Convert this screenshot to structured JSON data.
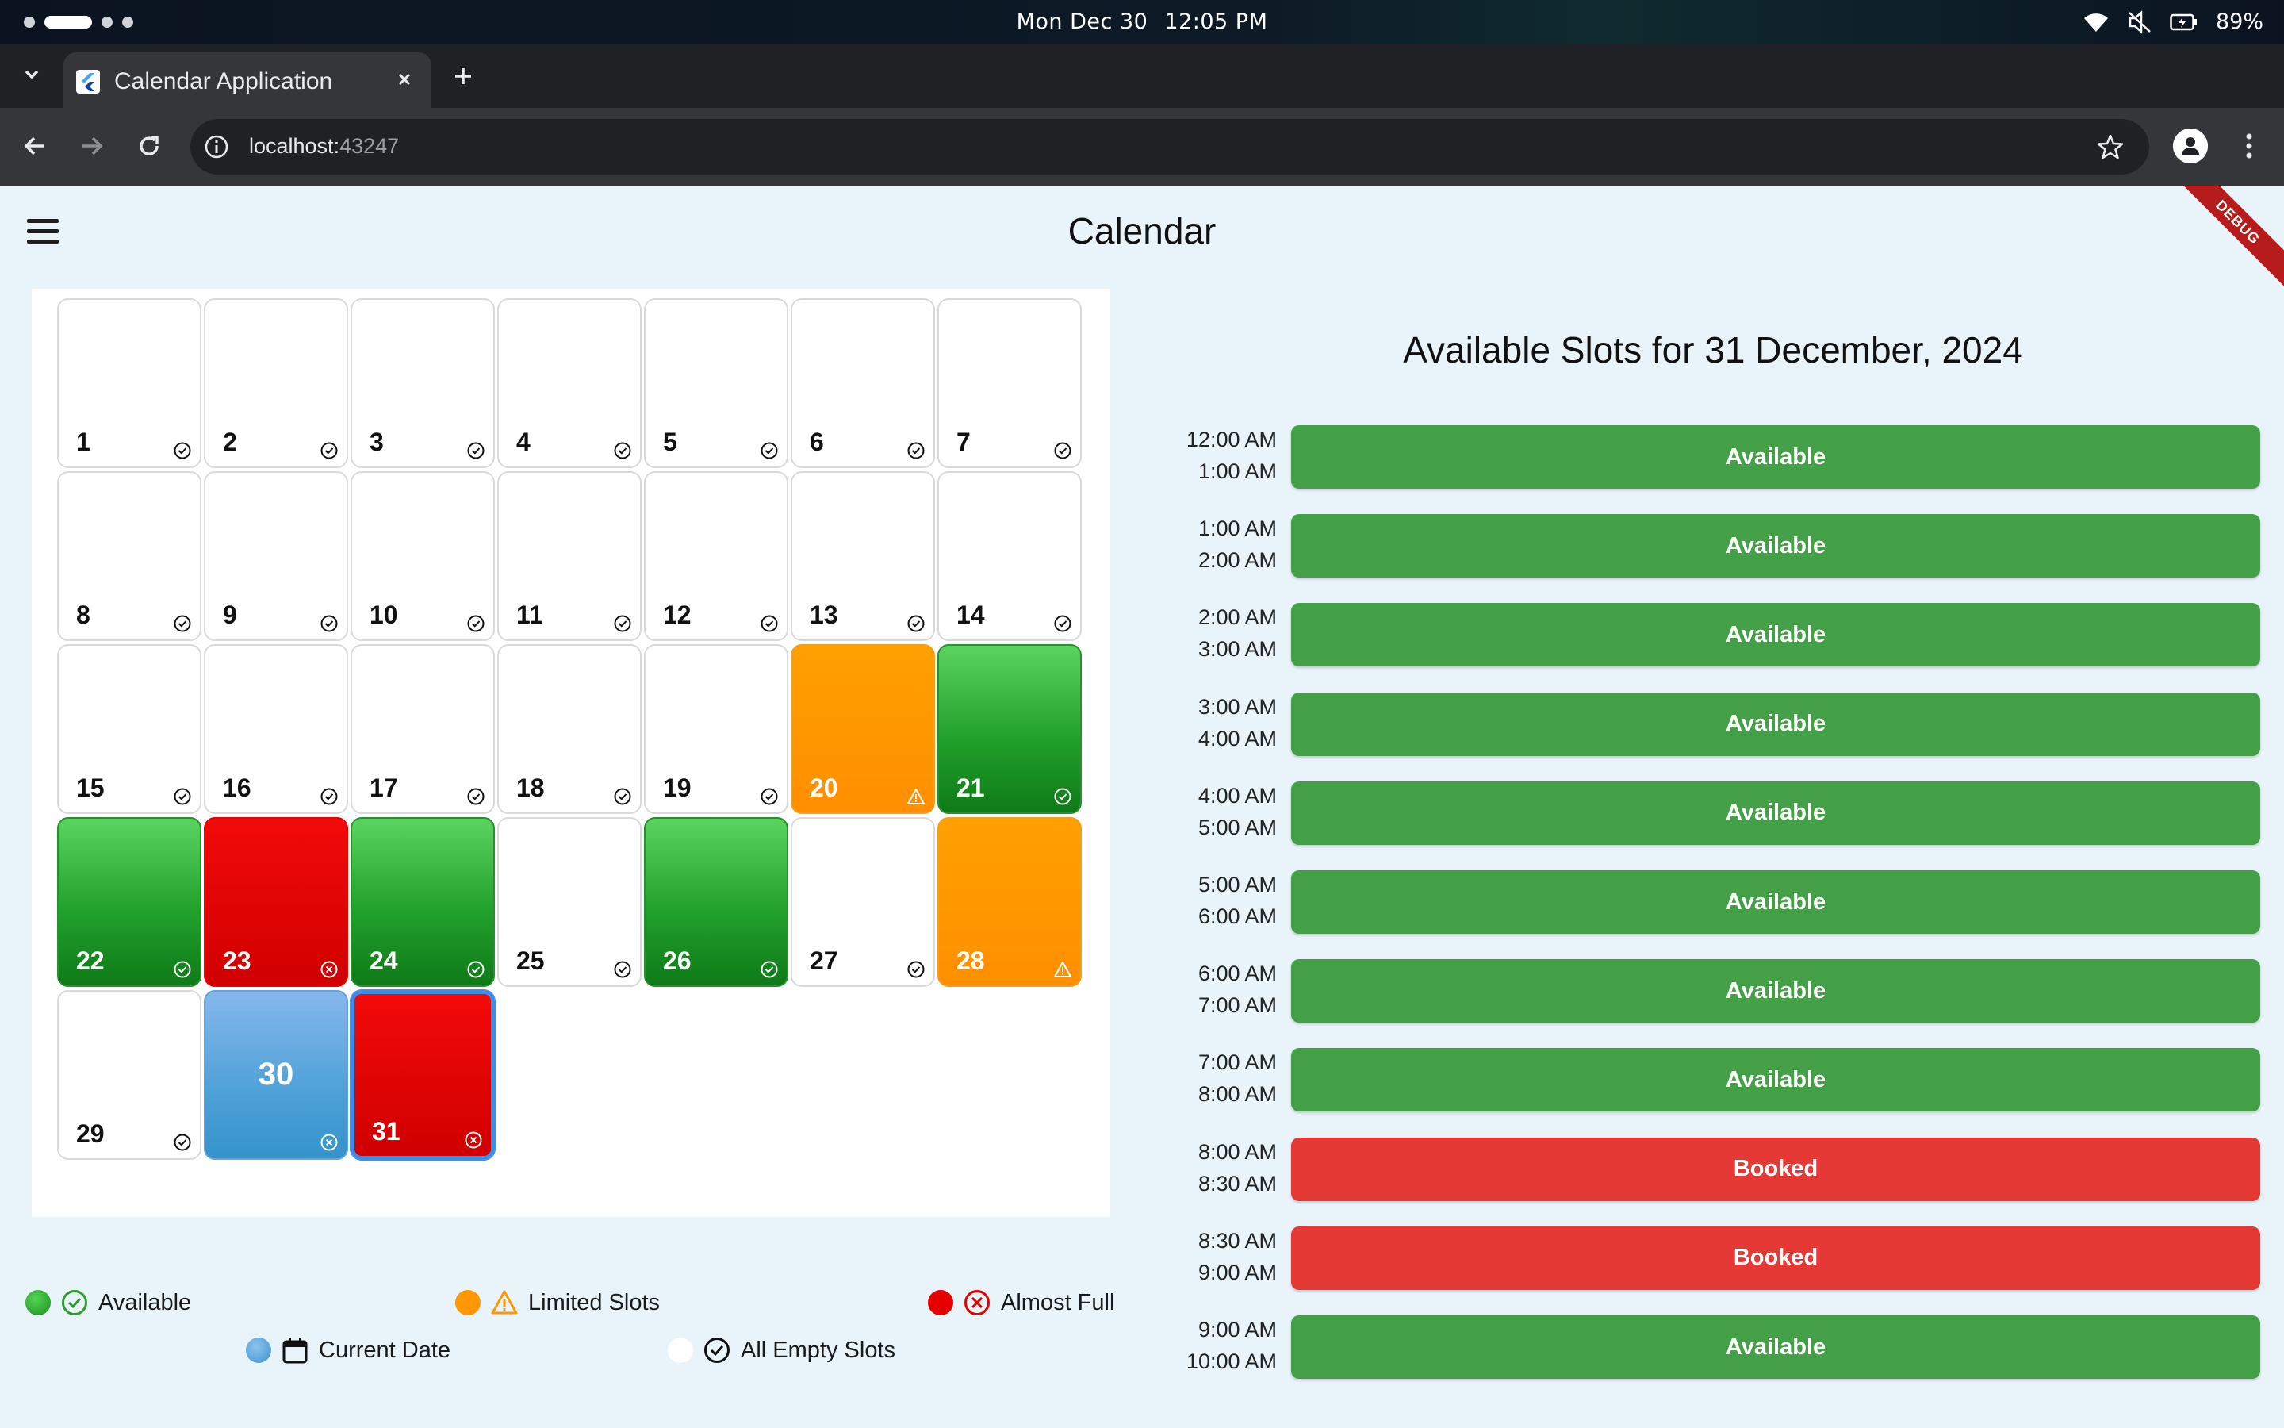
{
  "os": {
    "clock_day": "Mon Dec 30",
    "clock_time": "12:05 PM",
    "battery": "89%"
  },
  "browser": {
    "tab_title": "Calendar Application",
    "url_host": "localhost:",
    "url_port": "43247"
  },
  "app": {
    "title": "Calendar",
    "debug_banner": "DEBUG"
  },
  "calendar": {
    "days": [
      {
        "n": "1",
        "s": "empty",
        "icon": "check"
      },
      {
        "n": "2",
        "s": "empty",
        "icon": "check"
      },
      {
        "n": "3",
        "s": "empty",
        "icon": "check"
      },
      {
        "n": "4",
        "s": "empty",
        "icon": "check"
      },
      {
        "n": "5",
        "s": "empty",
        "icon": "check"
      },
      {
        "n": "6",
        "s": "empty",
        "icon": "check"
      },
      {
        "n": "7",
        "s": "empty",
        "icon": "check"
      },
      {
        "n": "8",
        "s": "empty",
        "icon": "check"
      },
      {
        "n": "9",
        "s": "empty",
        "icon": "check"
      },
      {
        "n": "10",
        "s": "empty",
        "icon": "check"
      },
      {
        "n": "11",
        "s": "empty",
        "icon": "check"
      },
      {
        "n": "12",
        "s": "empty",
        "icon": "check"
      },
      {
        "n": "13",
        "s": "empty",
        "icon": "check"
      },
      {
        "n": "14",
        "s": "empty",
        "icon": "check"
      },
      {
        "n": "15",
        "s": "empty",
        "icon": "check"
      },
      {
        "n": "16",
        "s": "empty",
        "icon": "check"
      },
      {
        "n": "17",
        "s": "empty",
        "icon": "check"
      },
      {
        "n": "18",
        "s": "empty",
        "icon": "check"
      },
      {
        "n": "19",
        "s": "empty",
        "icon": "check"
      },
      {
        "n": "20",
        "s": "orange",
        "icon": "warning"
      },
      {
        "n": "21",
        "s": "green",
        "icon": "check"
      },
      {
        "n": "22",
        "s": "green",
        "icon": "check"
      },
      {
        "n": "23",
        "s": "red",
        "icon": "cross"
      },
      {
        "n": "24",
        "s": "green",
        "icon": "check"
      },
      {
        "n": "25",
        "s": "empty",
        "icon": "check"
      },
      {
        "n": "26",
        "s": "green",
        "icon": "check"
      },
      {
        "n": "27",
        "s": "empty",
        "icon": "check"
      },
      {
        "n": "28",
        "s": "orange",
        "icon": "warning"
      },
      {
        "n": "29",
        "s": "empty",
        "icon": "check"
      },
      {
        "n": "30",
        "s": "current",
        "icon": "cross"
      },
      {
        "n": "31",
        "s": "red selected",
        "icon": "cross"
      }
    ]
  },
  "legend": {
    "available": "Available",
    "limited": "Limited Slots",
    "almost_full": "Almost Full",
    "current": "Current Date",
    "empty": "All Empty Slots"
  },
  "slots": {
    "title": "Available Slots for 31 December, 2024",
    "items": [
      {
        "start": "12:00 AM",
        "end": "1:00 AM",
        "label": "Available",
        "status": "available"
      },
      {
        "start": "1:00 AM",
        "end": "2:00 AM",
        "label": "Available",
        "status": "available"
      },
      {
        "start": "2:00 AM",
        "end": "3:00 AM",
        "label": "Available",
        "status": "available"
      },
      {
        "start": "3:00 AM",
        "end": "4:00 AM",
        "label": "Available",
        "status": "available"
      },
      {
        "start": "4:00 AM",
        "end": "5:00 AM",
        "label": "Available",
        "status": "available"
      },
      {
        "start": "5:00 AM",
        "end": "6:00 AM",
        "label": "Available",
        "status": "available"
      },
      {
        "start": "6:00 AM",
        "end": "7:00 AM",
        "label": "Available",
        "status": "available"
      },
      {
        "start": "7:00 AM",
        "end": "8:00 AM",
        "label": "Available",
        "status": "available"
      },
      {
        "start": "8:00 AM",
        "end": "8:30 AM",
        "label": "Booked",
        "status": "booked"
      },
      {
        "start": "8:30 AM",
        "end": "9:00 AM",
        "label": "Booked",
        "status": "booked"
      },
      {
        "start": "9:00 AM",
        "end": "10:00 AM",
        "label": "Available",
        "status": "available"
      }
    ]
  },
  "colors": {
    "available_green": "#43a047",
    "booked_red": "#e53935",
    "legend_green": "#2e9d2e",
    "legend_orange": "#ff9800",
    "legend_red": "#e50000",
    "legend_blue": "#5ea9dc"
  }
}
